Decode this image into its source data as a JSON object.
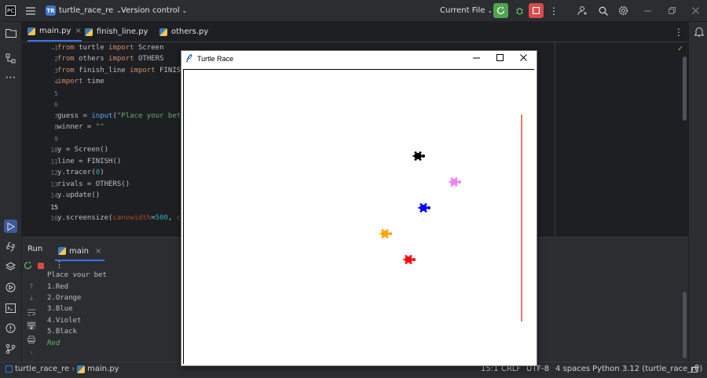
{
  "titlebar": {
    "project_badge": "TR",
    "project_name": "turtle_race_re",
    "vcs_label": "Version control",
    "run_config": "Current File",
    "icons": [
      "app-logo-icon",
      "hamburger-menu-icon",
      "chevron-down-icon",
      "run-icon",
      "debug-icon",
      "stop-icon",
      "more-icon",
      "add-user-icon",
      "search-icon",
      "settings-icon",
      "minimize-icon",
      "restore-icon",
      "close-icon"
    ]
  },
  "tabs": [
    {
      "label": "main.py",
      "active": true
    },
    {
      "label": "finish_line.py",
      "active": false
    },
    {
      "label": "others.py",
      "active": false
    }
  ],
  "editor": {
    "line_numbers": [
      "1",
      "2",
      "3",
      "4",
      "5",
      "6",
      "7",
      "8",
      "9",
      "10",
      "11",
      "12",
      "13",
      "14",
      "15",
      "16"
    ],
    "current_line": "15"
  },
  "run_panel": {
    "title": "Run",
    "tab_label": "main",
    "output": [
      "Place your bet",
      "1.Red",
      "2.Orange",
      "3.Blue",
      "4.Violet",
      "5.Black",
      "Red"
    ]
  },
  "turtle_window": {
    "title": "Turtle Race",
    "finish_line_color": "#e04a3f",
    "turtles": [
      {
        "color": "#000000"
      },
      {
        "color": "#ee82ee"
      },
      {
        "color": "#0000ff"
      },
      {
        "color": "#ffa500"
      },
      {
        "color": "#ff0000"
      }
    ]
  },
  "statusbar": {
    "project": "turtle_race_re",
    "file": "main.py",
    "position": "15:1",
    "line_endings": "CRLF",
    "encoding": "UTF-8",
    "indent": "4 spaces",
    "interpreter": "Python 3.12 (turtle_race_re)"
  },
  "colors": {
    "accent": "#3574f0",
    "run_green": "#4ea44e",
    "stop_red": "#d94a4a",
    "keyword": "#cf8e6d",
    "string": "#6aab73"
  }
}
